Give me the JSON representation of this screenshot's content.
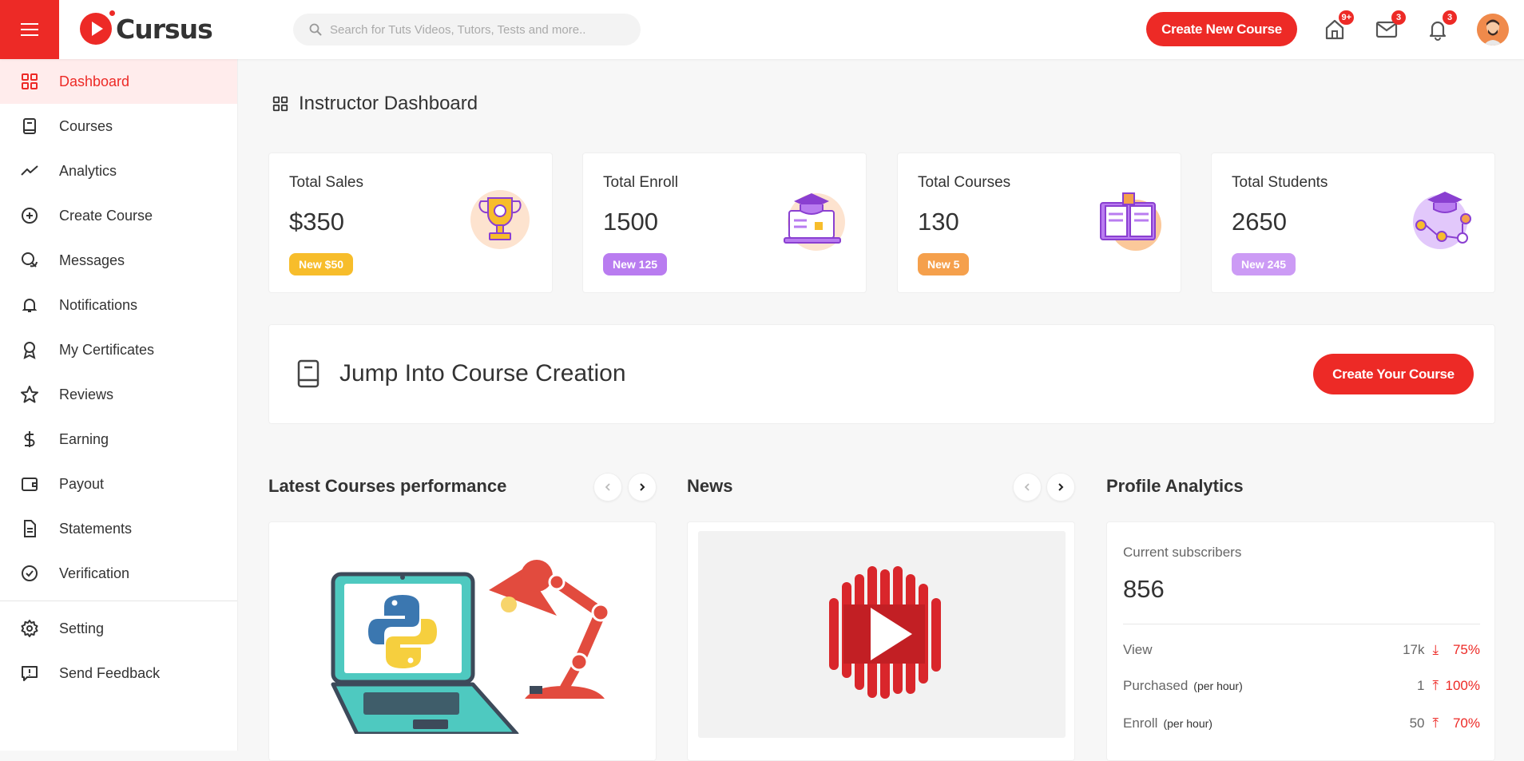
{
  "header": {
    "brand": "Cursus",
    "search_placeholder": "Search for Tuts Videos, Tutors, Tests and more..",
    "create_button": "Create New Course",
    "badges": {
      "home": "9+",
      "mail": "3",
      "notifications": "3"
    },
    "accent_color": "#ed2a26"
  },
  "sidebar": {
    "items": [
      {
        "label": "Dashboard",
        "icon": "grid-icon",
        "active": true
      },
      {
        "label": "Courses",
        "icon": "book-icon"
      },
      {
        "label": "Analytics",
        "icon": "trend-icon"
      },
      {
        "label": "Create Course",
        "icon": "plus-circle-icon"
      },
      {
        "label": "Messages",
        "icon": "chat-icon"
      },
      {
        "label": "Notifications",
        "icon": "bell-icon"
      },
      {
        "label": "My Certificates",
        "icon": "award-icon"
      },
      {
        "label": "Reviews",
        "icon": "star-icon"
      },
      {
        "label": "Earning",
        "icon": "dollar-icon"
      },
      {
        "label": "Payout",
        "icon": "wallet-icon"
      },
      {
        "label": "Statements",
        "icon": "document-icon"
      },
      {
        "label": "Verification",
        "icon": "check-circle-icon"
      }
    ],
    "bottom_items": [
      {
        "label": "Setting",
        "icon": "gear-icon"
      },
      {
        "label": "Send Feedback",
        "icon": "feedback-icon"
      }
    ]
  },
  "main": {
    "title": "Instructor Dashboard",
    "stats": [
      {
        "title": "Total Sales",
        "value": "$350",
        "badge": "New $50",
        "badge_color": "#f7bd2b"
      },
      {
        "title": "Total Enroll",
        "value": "1500",
        "badge": "New 125",
        "badge_color": "#b97cf0"
      },
      {
        "title": "Total Courses",
        "value": "130",
        "badge": "New 5",
        "badge_color": "#f5a04c"
      },
      {
        "title": "Total Students",
        "value": "2650",
        "badge": "New 245",
        "badge_color": "#cc9bf5"
      }
    ],
    "jump": {
      "text": "Jump Into Course Creation",
      "button": "Create Your Course"
    },
    "sections": {
      "latest": "Latest Courses performance",
      "news": "News",
      "profile": "Profile Analytics"
    },
    "profile_analytics": {
      "subscribers_label": "Current subscribers",
      "subscribers_value": "856",
      "rows": [
        {
          "name": "View",
          "sub": "",
          "value": "17k",
          "direction": "down",
          "percent": "75%"
        },
        {
          "name": "Purchased",
          "sub": "(per hour)",
          "value": "1",
          "direction": "up",
          "percent": "100%"
        },
        {
          "name": "Enroll",
          "sub": "(per hour)",
          "value": "50",
          "direction": "up",
          "percent": "70%"
        }
      ]
    }
  }
}
